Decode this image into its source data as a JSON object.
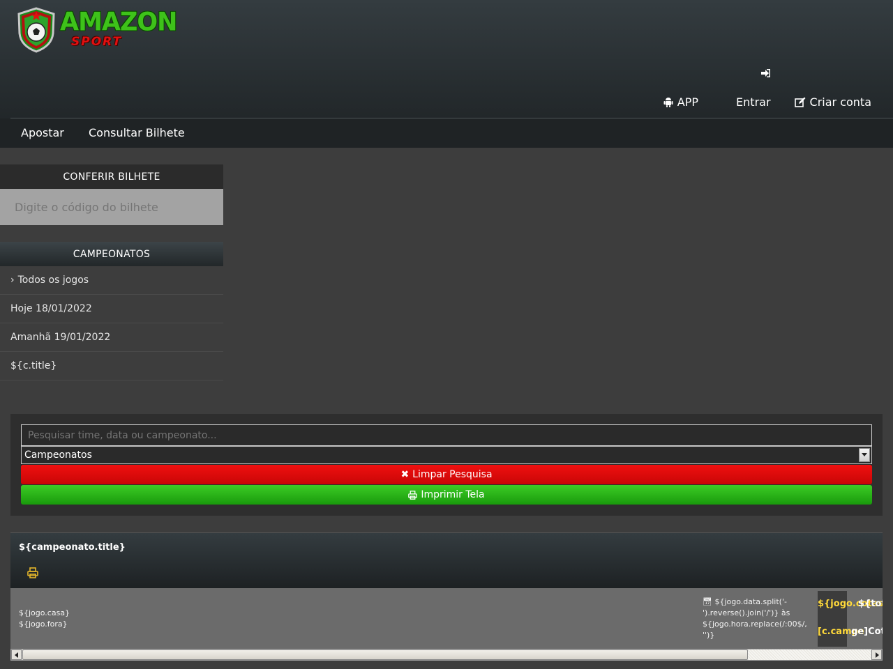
{
  "header": {
    "logo": {
      "word1": "AMAZON",
      "word2": "SPORT"
    },
    "login_icon": "sign-in-icon",
    "links": [
      {
        "icon": "android-icon",
        "label": "APP"
      },
      {
        "label": "Entrar"
      },
      {
        "icon": "edit-icon",
        "label": "Criar conta"
      }
    ]
  },
  "nav": {
    "items": [
      "Apostar",
      "Consultar Bilhete"
    ]
  },
  "ticket_check": {
    "title": "CONFERIR BILHETE",
    "placeholder": "Digite o código do bilhete"
  },
  "championships": {
    "title": "CAMPEONATOS",
    "items": [
      "Todos os jogos",
      "Hoje 18/01/2022",
      "Amanhã 19/01/2022",
      "${c.title}"
    ]
  },
  "search": {
    "placeholder": "Pesquisar time, data ou campeonato...",
    "select_value": "Campeonatos",
    "clear_label": "Limpar Pesquisa",
    "print_label": "Imprimir Tela"
  },
  "results": {
    "title": "${campeonato.title}",
    "game": {
      "home": "${jogo.casa}",
      "away": "${jogo.fora}",
      "date": "${jogo.data.split('-').reverse().join('/')} às ${jogo.hora.replace(/:00$/, '')}",
      "odd_top_a": "${jogo.cotas",
      "odd_top_b": "${tota",
      "odd_bottom_a": "[c.campe",
      "odd_bottom_b": "ge]Cota"
    }
  },
  "colors": {
    "clear_button": "#e80c0c",
    "print_button": "#2bb41a",
    "odd_highlight": "#ffd93a"
  }
}
